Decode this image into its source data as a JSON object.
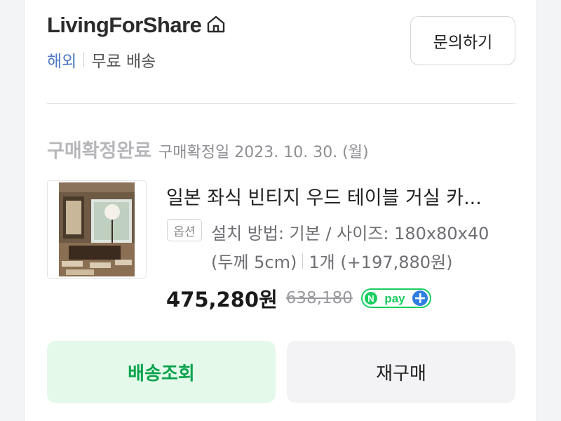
{
  "store": {
    "name": "LivingForShare",
    "tag_overseas": "해외",
    "tag_shipping": "무료 배송"
  },
  "header": {
    "inquiry_label": "문의하기"
  },
  "order": {
    "status": "구매확정완료",
    "confirm_date": "구매확정일 2023. 10. 30. (월)"
  },
  "product": {
    "title": "일본 좌식 빈티지 우드 테이블 거실 카...",
    "option_badge": "옵션",
    "option_line1": "설치 방법: 기본 / 사이즈: 180x80x40",
    "option_line2": "(두께 5cm)",
    "quantity": "1개 (+197,880원)",
    "price": "475,280원",
    "original_price": "638,180",
    "npay_label": "pay"
  },
  "actions": {
    "track_label": "배송조회",
    "reorder_label": "재구매"
  },
  "colors": {
    "accent_green": "#0aa34d",
    "overseas_blue": "#4d79c4",
    "npay_green": "#19ce60",
    "npay_blue": "#2f7de1"
  }
}
